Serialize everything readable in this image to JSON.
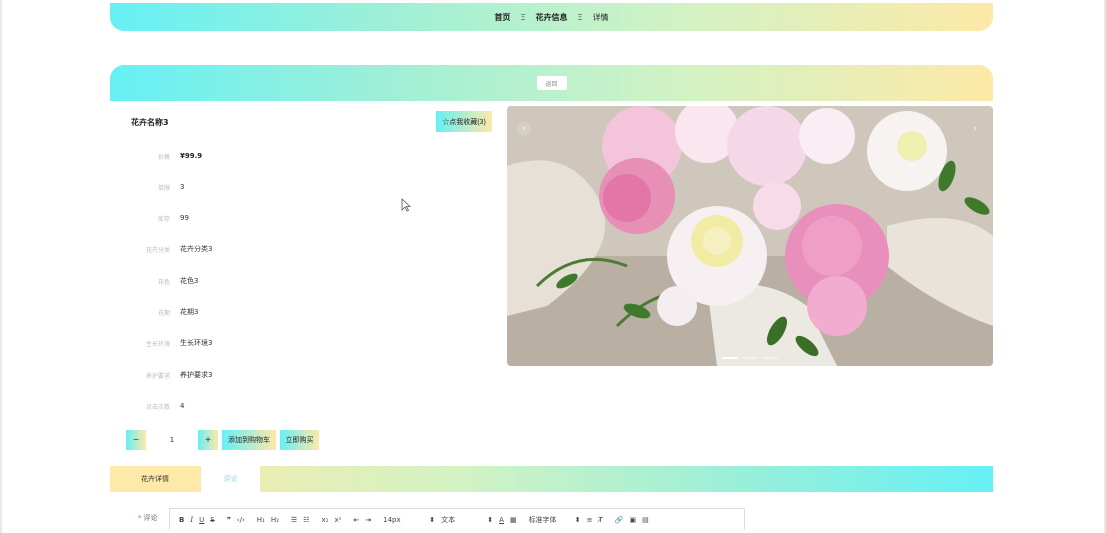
{
  "breadcrumb": {
    "home": "首页",
    "separator": "Ξ",
    "section": "花卉信息",
    "current": "详情"
  },
  "return_button": {
    "label": "返回"
  },
  "product": {
    "name": "花卉名称3",
    "favorite_label": "☆点我收藏(3)",
    "attributes": [
      {
        "label": "价格",
        "value": "¥99.9"
      },
      {
        "label": "单限",
        "value": "3"
      },
      {
        "label": "库存",
        "value": "99"
      },
      {
        "label": "花卉分类",
        "value": "花卉分类3"
      },
      {
        "label": "花色",
        "value": "花色3"
      },
      {
        "label": "花期",
        "value": "花期3"
      },
      {
        "label": "生长环境",
        "value": "生长环境3"
      },
      {
        "label": "养护要求",
        "value": "养护要求3"
      },
      {
        "label": "点击次数",
        "value": "4"
      }
    ]
  },
  "purchase": {
    "minus": "−",
    "quantity": "1",
    "plus": "+",
    "add_to_cart": "添加到购物车",
    "buy_now": "立即购买"
  },
  "carousel": {
    "prev": "‹",
    "next": "›",
    "slide_count": 3,
    "active_slide": 1
  },
  "tabs": [
    {
      "label": "花卉详情"
    },
    {
      "label": "评论"
    }
  ],
  "comment": {
    "required_mark": "*",
    "label": "评论",
    "toolbar": {
      "bold": "B",
      "italic": "I",
      "underline": "U",
      "strike": "S",
      "quote": "❞",
      "code": "‹/›",
      "h1": "H₁",
      "h2": "H₂",
      "ordered_list": "☰",
      "bullet_list": "☷",
      "subscript": "x₁",
      "superscript": "x¹",
      "indent_left": "⇤",
      "indent_right": "⇥",
      "font_size": "14px",
      "header_select": "文本",
      "font_color": "A",
      "background": "▦",
      "font_family": "标准字体",
      "align": "≡",
      "clean": "T̸",
      "link": "🔗",
      "image": "▣",
      "video": "▤",
      "select_arrow": "⬍"
    }
  }
}
